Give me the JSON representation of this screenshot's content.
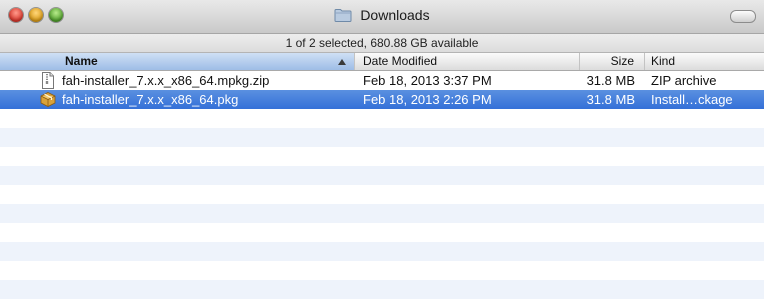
{
  "window": {
    "title": "Downloads"
  },
  "status": {
    "text": "1 of 2 selected, 680.88 GB available"
  },
  "columns": {
    "name": "Name",
    "date": "Date Modified",
    "size": "Size",
    "kind": "Kind"
  },
  "files": [
    {
      "name": "fah-installer_7.x.x_x86_64.mpkg.zip",
      "date": "Feb 18, 2013 3:37 PM",
      "size": "31.8 MB",
      "kind": "ZIP archive",
      "icon": "zip-document-icon",
      "selected": false
    },
    {
      "name": "fah-installer_7.x.x_x86_64.pkg",
      "date": "Feb 18, 2013 2:26 PM",
      "size": "31.8 MB",
      "kind": "Install…ckage",
      "icon": "package-icon",
      "selected": true
    }
  ],
  "colors": {
    "selection": "#3A74DA",
    "stripe": "#EEF3FB",
    "sorted_header": "#A9C5EC"
  }
}
